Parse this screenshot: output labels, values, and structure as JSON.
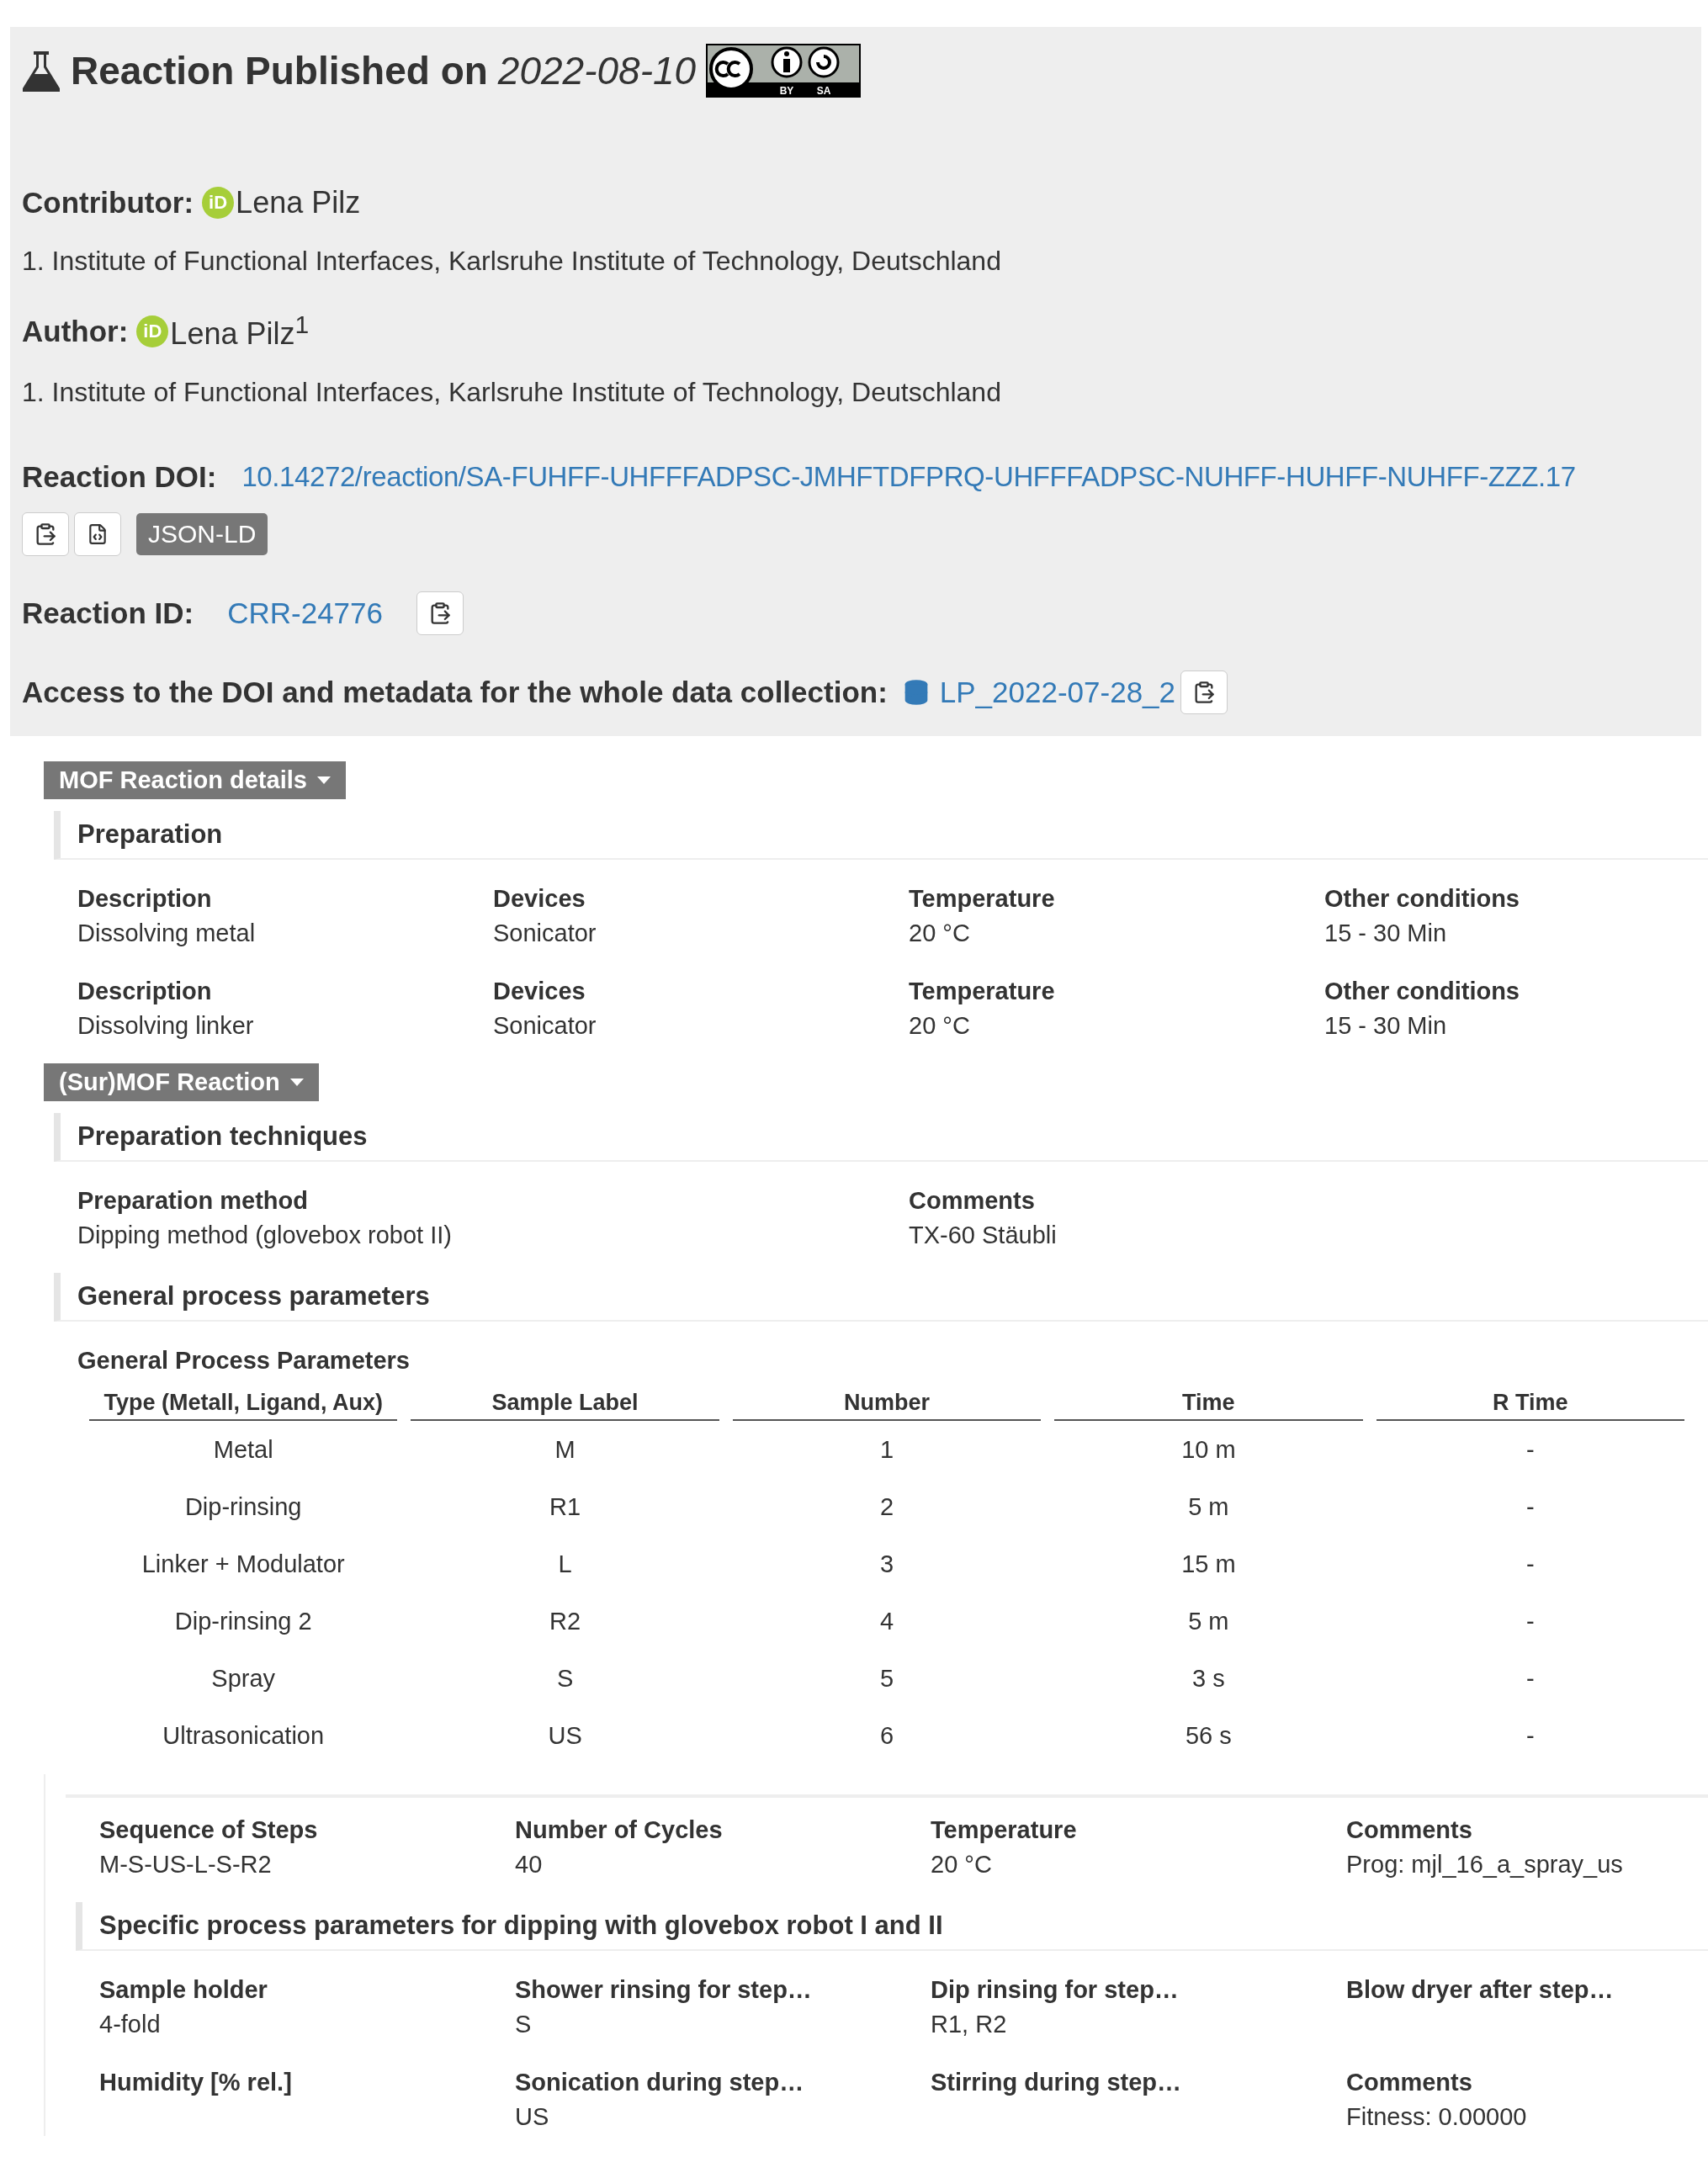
{
  "header": {
    "title": "Reaction Published on",
    "date": "2022-08-10",
    "license": [
      "BY",
      "SA"
    ]
  },
  "contributor": {
    "label": "Contributor:",
    "orcid": "iD",
    "name": "Lena Pilz",
    "affiliation": "1. Institute of Functional Interfaces, Karlsruhe Institute of Technology, Deutschland"
  },
  "author": {
    "label": "Author:",
    "orcid": "iD",
    "name": "Lena Pilz",
    "sup": "1",
    "affiliation": "1. Institute of Functional Interfaces, Karlsruhe Institute of Technology, Deutschland"
  },
  "doi": {
    "label": "Reaction DOI:",
    "value": "10.14272/reaction/SA-FUHFF-UHFFFADPSC-JMHFTDFPRQ-UHFFFADPSC-NUHFF-HUHFF-NUHFF-ZZZ.17",
    "badge": "JSON-LD"
  },
  "reaction_id": {
    "label": "Reaction ID:",
    "value": "CRR-24776"
  },
  "collection": {
    "label": "Access to the DOI and metadata for the whole data collection:",
    "value": "LP_2022-07-28_2"
  },
  "panels": [
    {
      "toggle": "MOF Reaction details",
      "blocks": [
        {
          "kind": "heading",
          "text": "Preparation"
        },
        {
          "kind": "fields",
          "items": [
            {
              "label": "Description",
              "value": "Dissolving metal"
            },
            {
              "label": "Devices",
              "value": "Sonicator"
            },
            {
              "label": "Temperature",
              "value": "20 °C"
            },
            {
              "label": "Other conditions",
              "value": "15 - 30 Min"
            },
            {
              "label": "Description",
              "value": "Dissolving linker"
            },
            {
              "label": "Devices",
              "value": "Sonicator"
            },
            {
              "label": "Temperature",
              "value": "20 °C"
            },
            {
              "label": "Other conditions",
              "value": "15 - 30 Min"
            }
          ]
        }
      ]
    },
    {
      "toggle": "(Sur)MOF Reaction",
      "blocks": [
        {
          "kind": "heading",
          "text": "Preparation techniques"
        },
        {
          "kind": "fields",
          "items": [
            {
              "label": "Preparation method",
              "value": "Dipping method (glovebox robot II)"
            },
            {
              "label": "Comments",
              "value": "TX-60 Stäubli"
            }
          ]
        },
        {
          "kind": "heading",
          "text": "General process parameters"
        },
        {
          "kind": "table",
          "title": "General Process Parameters",
          "columns": [
            "Type (Metall, Ligand, Aux)",
            "Sample Label",
            "Number",
            "Time",
            "R Time"
          ],
          "rows": [
            [
              "Metal",
              "M",
              "1",
              "10 m",
              "-"
            ],
            [
              "Dip-rinsing",
              "R1",
              "2",
              "5 m",
              "-"
            ],
            [
              "Linker + Modulator",
              "L",
              "3",
              "15 m",
              "-"
            ],
            [
              "Dip-rinsing 2",
              "R2",
              "4",
              "5 m",
              "-"
            ],
            [
              "Spray",
              "S",
              "5",
              "3 s",
              "-"
            ],
            [
              "Ultrasonication",
              "US",
              "6",
              "56 s",
              "-"
            ]
          ]
        },
        {
          "kind": "group",
          "blocks": [
            {
              "kind": "fields",
              "items": [
                {
                  "label": "Sequence of Steps",
                  "value": "M-S-US-L-S-R2"
                },
                {
                  "label": "Number of Cycles",
                  "value": "40"
                },
                {
                  "label": "Temperature",
                  "value": "20 °C"
                },
                {
                  "label": "Comments",
                  "value": "Prog: mjl_16_a_spray_us"
                }
              ]
            },
            {
              "kind": "heading",
              "text": "Specific process parameters for dipping with glovebox robot I and II"
            },
            {
              "kind": "fields",
              "items": [
                {
                  "label": "Sample holder",
                  "value": "4-fold"
                },
                {
                  "label": "Shower rinsing for step…",
                  "value": "S"
                },
                {
                  "label": "Dip rinsing for step…",
                  "value": "R1, R2"
                },
                {
                  "label": "Blow dryer after step…"
                },
                {
                  "label": "Humidity [% rel.]"
                },
                {
                  "label": "Sonication during step…",
                  "value": "US"
                },
                {
                  "label": "Stirring during step…"
                },
                {
                  "label": "Comments",
                  "value": "Fitness: 0.00000"
                }
              ]
            }
          ]
        }
      ]
    }
  ]
}
